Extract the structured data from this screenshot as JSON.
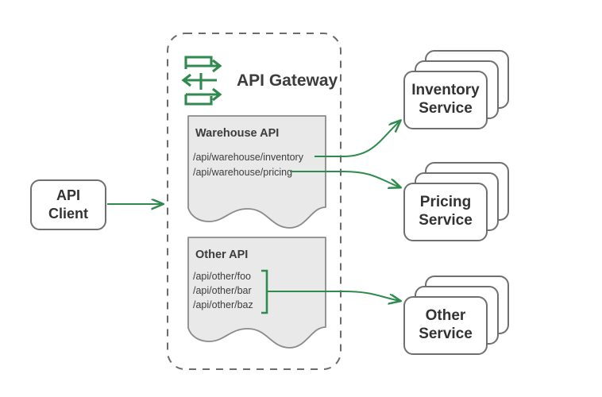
{
  "diagram": {
    "title": "API Gateway routing diagram",
    "colors": {
      "green": "#2f8a4e",
      "border_gray": "#777777",
      "dash_gray": "#6b6b6b",
      "box_fill": "#e9e9e9",
      "text_dark": "#3b3b3b",
      "white": "#ffffff"
    }
  },
  "client": {
    "line1": "API",
    "line2": "Client",
    "icon": "rounded-rect-node"
  },
  "gateway": {
    "title": "API Gateway",
    "icon": "api-gateway-arrows-icon",
    "boundary": "dashed-rounded-container",
    "apis": [
      {
        "id": "warehouse",
        "title": "Warehouse API",
        "shape": "torn-document",
        "paths": [
          {
            "text": "/api/warehouse/inventory",
            "target": "inventory"
          },
          {
            "text": "/api/warehouse/pricing",
            "target": "pricing"
          }
        ],
        "grouped": false
      },
      {
        "id": "other",
        "title": "Other API",
        "shape": "torn-document",
        "paths": [
          {
            "text": "/api/other/foo",
            "target": "other"
          },
          {
            "text": "/api/other/bar",
            "target": "other"
          },
          {
            "text": "/api/other/baz",
            "target": "other"
          }
        ],
        "grouped": true,
        "group_bracket": "right-brace"
      }
    ]
  },
  "services": [
    {
      "id": "inventory",
      "line1": "Inventory",
      "line2": "Service",
      "stack_count": 3
    },
    {
      "id": "pricing",
      "line1": "Pricing",
      "line2": "Service",
      "stack_count": 3
    },
    {
      "id": "other",
      "line1": "Other",
      "line2": "Service",
      "stack_count": 3
    }
  ],
  "connections": [
    {
      "from": "client",
      "to": "gateway-boundary",
      "style": "straight-arrow"
    },
    {
      "from": "warehouse-inventory",
      "to": "inventory",
      "style": "curved-arrow"
    },
    {
      "from": "warehouse-pricing",
      "to": "pricing",
      "style": "curved-arrow"
    },
    {
      "from": "other-group",
      "to": "other",
      "style": "curved-arrow"
    }
  ]
}
